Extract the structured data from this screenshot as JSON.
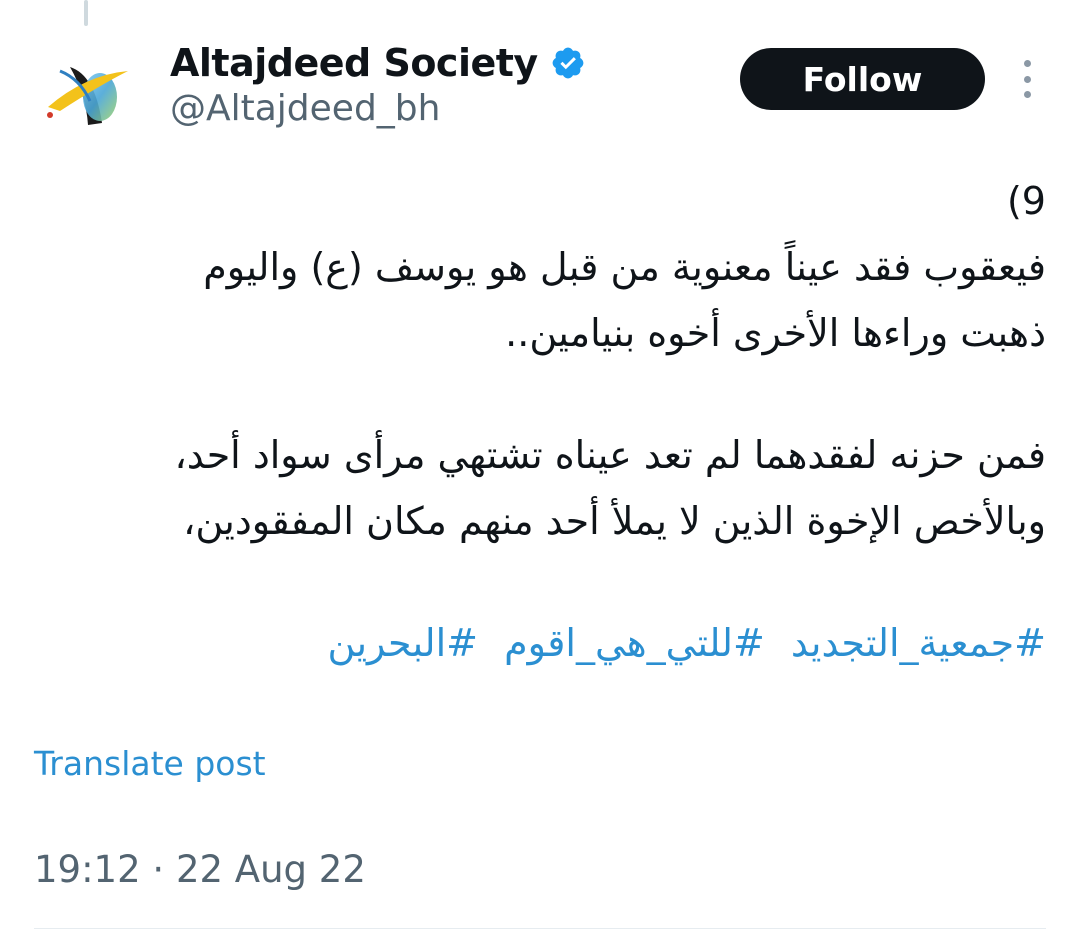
{
  "author": {
    "display_name": "Altajdeed Society",
    "handle": "@Altajdeed_bh",
    "verified": true,
    "avatar_icon": "altajdeed-logo-icon"
  },
  "actions": {
    "follow_label": "Follow",
    "more_icon": "more-options-icon"
  },
  "post": {
    "lines": [
      "(9",
      "فيعقوب فقد عيناً معنوية من قبل هو يوسف (ع) واليوم",
      "ذهبت وراءها الأخرى أخوه بنيامين..",
      "فمن حزنه لفقدهما لم تعد عيناه تشتهي مرأى سواد أحد،",
      "وبالأخص الإخوة الذين لا يملأ أحد منهم مكان المفقودين،"
    ],
    "hashtags": [
      "#جمعية_التجديد",
      "#للتي_هي_اقوم",
      "#البحرين"
    ],
    "translate_label": "Translate post",
    "time": "19:12",
    "date": "22 Aug 22",
    "separator": " · "
  },
  "colors": {
    "link": "#2b8fd1",
    "verified": "#1d9bf0",
    "muted": "#536471",
    "button_bg": "#0f1419"
  }
}
